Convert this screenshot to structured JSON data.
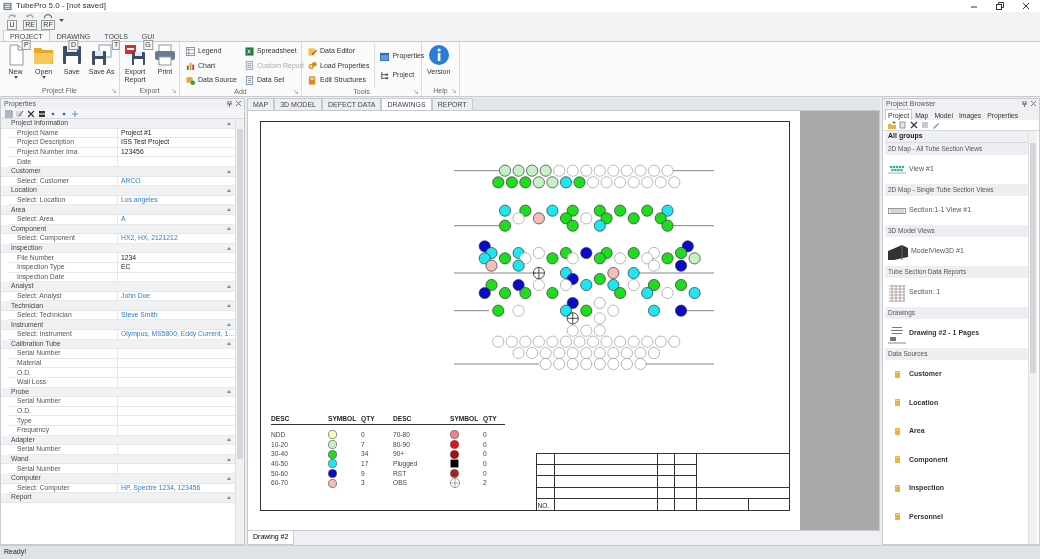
{
  "window": {
    "title": "TubePro 5.0 - [not saved]"
  },
  "quick_access": [
    {
      "keytip": "U"
    },
    {
      "keytip": "RE"
    },
    {
      "keytip": "RF"
    }
  ],
  "ribbon_tabs": [
    {
      "label": "PROJECT",
      "keytip": "P",
      "selected": true
    },
    {
      "label": "DRAWING",
      "keytip": "D",
      "selected": false
    },
    {
      "label": "TOOLS",
      "keytip": "T",
      "selected": false
    },
    {
      "label": "GUI",
      "keytip": "G",
      "selected": false
    }
  ],
  "ribbon_groups": [
    {
      "label": "Project File",
      "kind": "large",
      "items": [
        {
          "label": "New",
          "dropdown": true
        },
        {
          "label": "Open",
          "dropdown": true
        },
        {
          "label": "Save",
          "dropdown": false
        },
        {
          "label": "Save As",
          "dropdown": false
        }
      ]
    },
    {
      "label": "Export",
      "kind": "large",
      "items": [
        {
          "label": "Export Report",
          "dropdown": false
        },
        {
          "label": "Print",
          "dropdown": false
        }
      ]
    },
    {
      "label": "Add",
      "kind": "small",
      "columns": [
        [
          {
            "label": "Legend",
            "disabled": false
          },
          {
            "label": "Chart",
            "disabled": false
          },
          {
            "label": "Data Source",
            "disabled": false
          }
        ],
        [
          {
            "label": "Spreadsheet",
            "disabled": false
          },
          {
            "label": "Custom Report",
            "disabled": true
          },
          {
            "label": "Data Set",
            "disabled": false
          }
        ]
      ]
    },
    {
      "label": "Tools",
      "kind": "small",
      "columns": [
        [
          {
            "label": "Data Editor",
            "disabled": false
          },
          {
            "label": "Load Properties",
            "disabled": false
          },
          {
            "label": "Edit Structures",
            "disabled": false
          }
        ],
        [
          {
            "label": "Properties",
            "disabled": false
          },
          {
            "label": "Project",
            "disabled": false
          }
        ]
      ]
    },
    {
      "label": "Help",
      "kind": "large",
      "items": [
        {
          "label": "Version",
          "dropdown": false
        }
      ]
    }
  ],
  "properties_panel": {
    "title": "Properties",
    "categories": [
      {
        "name": "Project Information",
        "expanded": true,
        "rows": [
          {
            "label": "Project Name",
            "value": "Project #1",
            "kind": "text"
          },
          {
            "label": "Project Description",
            "value": "ISS Test Project",
            "kind": "text"
          },
          {
            "label": "Project Number Ima",
            "value": "123456",
            "kind": "text"
          },
          {
            "label": "Date",
            "kind": "text"
          }
        ]
      },
      {
        "name": "Customer",
        "expanded": true,
        "rows": [
          {
            "label": "Select: Customer",
            "value": "ARCO",
            "kind": "link"
          }
        ]
      },
      {
        "name": "Location",
        "expanded": true,
        "rows": [
          {
            "label": "Select: Location",
            "value": "Los angeles",
            "kind": "link"
          }
        ]
      },
      {
        "name": "Area",
        "expanded": true,
        "rows": [
          {
            "label": "Select: Area",
            "value": "A",
            "kind": "link"
          }
        ]
      },
      {
        "name": "Component",
        "expanded": true,
        "rows": [
          {
            "label": "Select: Component",
            "value": "HX2, HX, 2121212",
            "kind": "link"
          }
        ]
      },
      {
        "name": "Inspection",
        "expanded": true,
        "rows": [
          {
            "label": "File Number",
            "value": "1234",
            "kind": "text"
          },
          {
            "label": "Inspection Type",
            "value": "EC",
            "kind": "text"
          },
          {
            "label": "Inspection Date",
            "kind": "text"
          }
        ]
      },
      {
        "name": "Analyst",
        "expanded": true,
        "rows": [
          {
            "label": "Select: Analyst",
            "value": "John Doe",
            "kind": "link"
          }
        ]
      },
      {
        "name": "Technician",
        "expanded": true,
        "rows": [
          {
            "label": "Select: Technician",
            "value": "Steve Smith",
            "kind": "link"
          }
        ]
      },
      {
        "name": "Instrument",
        "expanded": true,
        "rows": [
          {
            "label": "Select: Instrument",
            "value": "Olympus, MS5800, Eddy Current, 1…",
            "kind": "link"
          }
        ]
      },
      {
        "name": "Calibration Tube",
        "expanded": true,
        "rows": [
          {
            "label": "Serial Number",
            "kind": "text"
          },
          {
            "label": "Material",
            "kind": "text"
          },
          {
            "label": "O.D.",
            "kind": "text"
          },
          {
            "label": "Wall Loss",
            "kind": "text"
          }
        ]
      },
      {
        "name": "Probe",
        "expanded": true,
        "rows": [
          {
            "label": "Serial Number",
            "kind": "text"
          },
          {
            "label": "O.D.",
            "kind": "text"
          },
          {
            "label": "Type",
            "kind": "text"
          },
          {
            "label": "Frequency",
            "kind": "text"
          }
        ]
      },
      {
        "name": "Adapter",
        "expanded": true,
        "rows": [
          {
            "label": "Serial Number",
            "kind": "text"
          }
        ]
      },
      {
        "name": "Wand",
        "expanded": true,
        "rows": [
          {
            "label": "Serial Number",
            "kind": "text"
          }
        ]
      },
      {
        "name": "Computer",
        "expanded": true,
        "rows": [
          {
            "label": "Select: Computer",
            "value": "HP, Spectre 1234, 123456",
            "kind": "link"
          }
        ]
      },
      {
        "name": "Report",
        "expanded": true
      }
    ]
  },
  "document_tabs": [
    {
      "label": "MAP",
      "selected": false
    },
    {
      "label": "3D MODEL",
      "selected": false
    },
    {
      "label": "DEFECT DATA",
      "selected": false
    },
    {
      "label": "DRAWINGS",
      "selected": true
    },
    {
      "label": "REPORT",
      "selected": false
    }
  ],
  "drawing": {
    "legend_headers": [
      "DESC",
      "SYMBOL",
      "QTY",
      "DESC",
      "SYMBOL",
      "QTY"
    ],
    "legend": [
      {
        "desc": "NDD",
        "kind": "circle",
        "color": "#fffcc0",
        "qty": "0"
      },
      {
        "desc": "10-20",
        "kind": "circle",
        "color": "#c4f2c4",
        "qty": "7"
      },
      {
        "desc": "30-40",
        "kind": "circle",
        "color": "#1edc1e",
        "qty": "34"
      },
      {
        "desc": "40-50",
        "kind": "circle",
        "color": "#1ee6f0",
        "qty": "17"
      },
      {
        "desc": "50-60",
        "kind": "circle",
        "color": "#0a0ac8",
        "qty": "9"
      },
      {
        "desc": "60-70",
        "kind": "circle",
        "color": "#f4bcbc",
        "qty": "3"
      },
      {
        "desc": "70-80",
        "kind": "circle",
        "color": "#f08484",
        "qty": "0"
      },
      {
        "desc": "80-90",
        "kind": "circle",
        "color": "#e81010",
        "qty": "0"
      },
      {
        "desc": "90+",
        "kind": "circle",
        "color": "#b00a0a",
        "qty": "0"
      },
      {
        "desc": "Plugged",
        "kind": "square",
        "color": "#000000",
        "qty": "0"
      },
      {
        "desc": "RST",
        "kind": "ring",
        "color": "#a02828",
        "qty": "0"
      },
      {
        "desc": "OBS",
        "kind": "cross",
        "qty": "2"
      }
    ],
    "title_block": {
      "number_label": "NO."
    },
    "sheet_tab": "Drawing #2"
  },
  "project_browser": {
    "title": "Project Browser",
    "tabs": [
      {
        "label": "Project",
        "selected": true
      },
      {
        "label": "Map",
        "selected": false
      },
      {
        "label": "Model",
        "selected": false
      },
      {
        "label": "Images",
        "selected": false
      },
      {
        "label": "Properties",
        "selected": false
      }
    ],
    "header": "All groups",
    "groups": [
      {
        "title": "2D Map - All Tube Section Views",
        "items": [
          {
            "label": "View #1",
            "kind": "map"
          }
        ]
      },
      {
        "title": "2D Map - Single Tube Section Views",
        "items": [
          {
            "label": "Section:1-1 View #1",
            "kind": "section"
          }
        ]
      },
      {
        "title": "3D Model Views",
        "items": [
          {
            "label": "ModelView3D #1",
            "kind": "model"
          }
        ]
      },
      {
        "title": "Tube Section Data Reports",
        "items": [
          {
            "label": "Section: 1",
            "kind": "report"
          }
        ]
      },
      {
        "title": "Drawings",
        "items": [
          {
            "label": "Drawing #2 - 1 Pages",
            "kind": "drawing"
          }
        ]
      },
      {
        "title": "Data Sources",
        "items": [
          {
            "label": "Customer",
            "kind": "source"
          },
          {
            "label": "Location",
            "kind": "source"
          },
          {
            "label": "Area",
            "kind": "source"
          },
          {
            "label": "Component",
            "kind": "source"
          },
          {
            "label": "Inspection",
            "kind": "source"
          },
          {
            "label": "Personnel",
            "kind": "source"
          }
        ]
      }
    ]
  },
  "status_bar": "Ready!"
}
